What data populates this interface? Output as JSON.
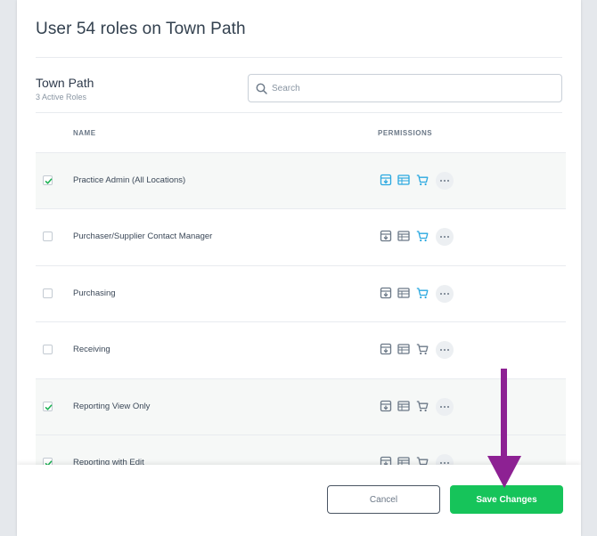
{
  "modal": {
    "title": "User 54 roles on Town Path"
  },
  "location": {
    "name": "Town Path",
    "subtitle": "3 Active Roles"
  },
  "search": {
    "placeholder": "Search",
    "value": ""
  },
  "table": {
    "headers": {
      "name": "NAME",
      "permissions": "PERMISSIONS"
    },
    "rows": [
      {
        "name": "Practice Admin (All Locations)",
        "checked": true,
        "perms": [
          "active",
          "active",
          "active"
        ]
      },
      {
        "name": "Purchaser/Supplier Contact Manager",
        "checked": false,
        "perms": [
          "inactive",
          "inactive",
          "active"
        ]
      },
      {
        "name": "Purchasing",
        "checked": false,
        "perms": [
          "inactive",
          "inactive",
          "active"
        ]
      },
      {
        "name": "Receiving",
        "checked": false,
        "perms": [
          "inactive",
          "inactive",
          "inactive"
        ]
      },
      {
        "name": "Reporting View Only",
        "checked": true,
        "perms": [
          "inactive",
          "inactive",
          "inactive"
        ]
      },
      {
        "name": "Reporting with Edit",
        "checked": true,
        "perms": [
          "inactive",
          "inactive",
          "inactive"
        ]
      }
    ]
  },
  "permission_icons": [
    "inventory-box-icon",
    "list-table-icon",
    "cart-icon"
  ],
  "colors": {
    "active": "#2aa8e0",
    "inactive": "#6b7887",
    "save": "#16c45a",
    "check": "#16b04f",
    "arrow": "#8d2193"
  },
  "footer": {
    "cancel_label": "Cancel",
    "save_label": "Save Changes"
  }
}
